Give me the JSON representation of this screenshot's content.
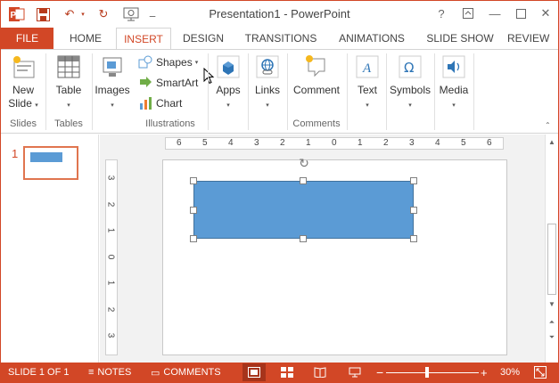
{
  "window": {
    "title": "Presentation1 - PowerPoint",
    "help_label": "?"
  },
  "quick_access": {
    "app_icon": "powerpoint-app-icon",
    "save_icon": "save-icon",
    "undo_icon": "undo-icon",
    "redo_icon": "redo-icon",
    "present_icon": "present-icon",
    "customize_icon": "customize-qat-icon"
  },
  "tabs": [
    {
      "label": "FILE"
    },
    {
      "label": "HOME"
    },
    {
      "label": "INSERT"
    },
    {
      "label": "DESIGN"
    },
    {
      "label": "TRANSITIONS"
    },
    {
      "label": "ANIMATIONS"
    },
    {
      "label": "SLIDE SHOW"
    },
    {
      "label": "REVIEW"
    }
  ],
  "ribbon": {
    "slides": {
      "new_slide": "New Slide",
      "group_label": "Slides"
    },
    "tables": {
      "table": "Table",
      "group_label": "Tables"
    },
    "images": {
      "images": "Images"
    },
    "illustrations": {
      "shapes": "Shapes",
      "smartart": "SmartArt",
      "chart": "Chart",
      "group_label": "Illustrations"
    },
    "apps": {
      "apps": "Apps"
    },
    "links": {
      "links": "Links"
    },
    "comments": {
      "comment": "Comment",
      "group_label": "Comments"
    },
    "text": {
      "text": "Text"
    },
    "symbols": {
      "symbols": "Symbols"
    },
    "media": {
      "media": "Media"
    }
  },
  "thumbnails": [
    {
      "number": "1"
    }
  ],
  "rulers": {
    "horizontal": [
      "6",
      "5",
      "4",
      "3",
      "2",
      "1",
      "0",
      "1",
      "2",
      "3",
      "4",
      "5",
      "6"
    ],
    "vertical": [
      "3",
      "2",
      "1",
      "0",
      "1",
      "2",
      "3"
    ]
  },
  "statusbar": {
    "slide_info": "SLIDE 1 OF 1",
    "notes": "NOTES",
    "comments": "COMMENTS",
    "zoom_minus": "−",
    "zoom_plus": "+",
    "zoom_level": "30%",
    "zoom_fraction": 0.3
  },
  "colors": {
    "accent": "#d24726",
    "shape_fill": "#5b9bd5"
  }
}
